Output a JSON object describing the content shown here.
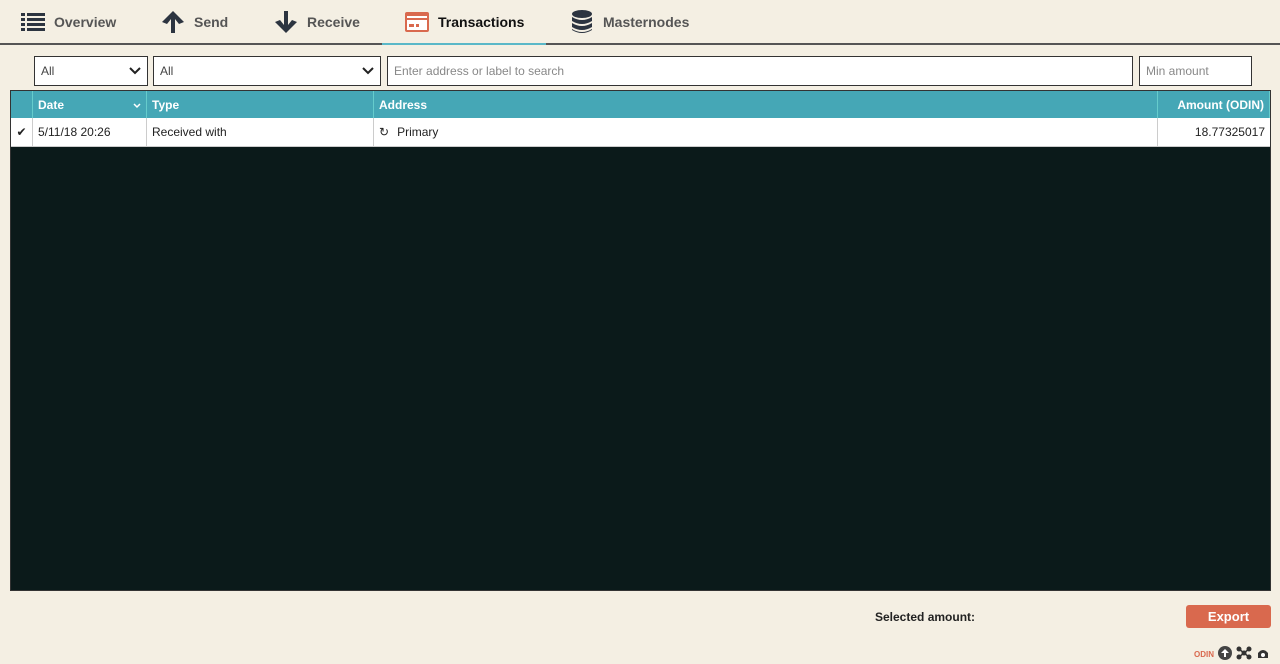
{
  "nav": {
    "tabs": [
      {
        "label": "Overview",
        "icon": "list-icon"
      },
      {
        "label": "Send",
        "icon": "arrow-up-icon"
      },
      {
        "label": "Receive",
        "icon": "arrow-down-icon"
      },
      {
        "label": "Transactions",
        "icon": "card-icon",
        "active": true
      },
      {
        "label": "Masternodes",
        "icon": "database-icon"
      }
    ]
  },
  "filters": {
    "date": "All",
    "type": "All",
    "search_placeholder": "Enter address or label to search",
    "min_amount_placeholder": "Min amount"
  },
  "table": {
    "headers": [
      "Date",
      "Type",
      "Address",
      "Amount (ODIN)"
    ],
    "rows": [
      {
        "date": "5/11/18 20:26",
        "type": "Received with",
        "address": "Primary",
        "amount": "18.77325017",
        "status": "confirmed"
      }
    ]
  },
  "footer": {
    "selected_amount_label": "Selected amount:",
    "export_label": "Export",
    "brand": "ODIN"
  },
  "colors": {
    "accent": "#d9694e",
    "header": "#45a7b6",
    "table_bg": "#0b1a1a"
  }
}
